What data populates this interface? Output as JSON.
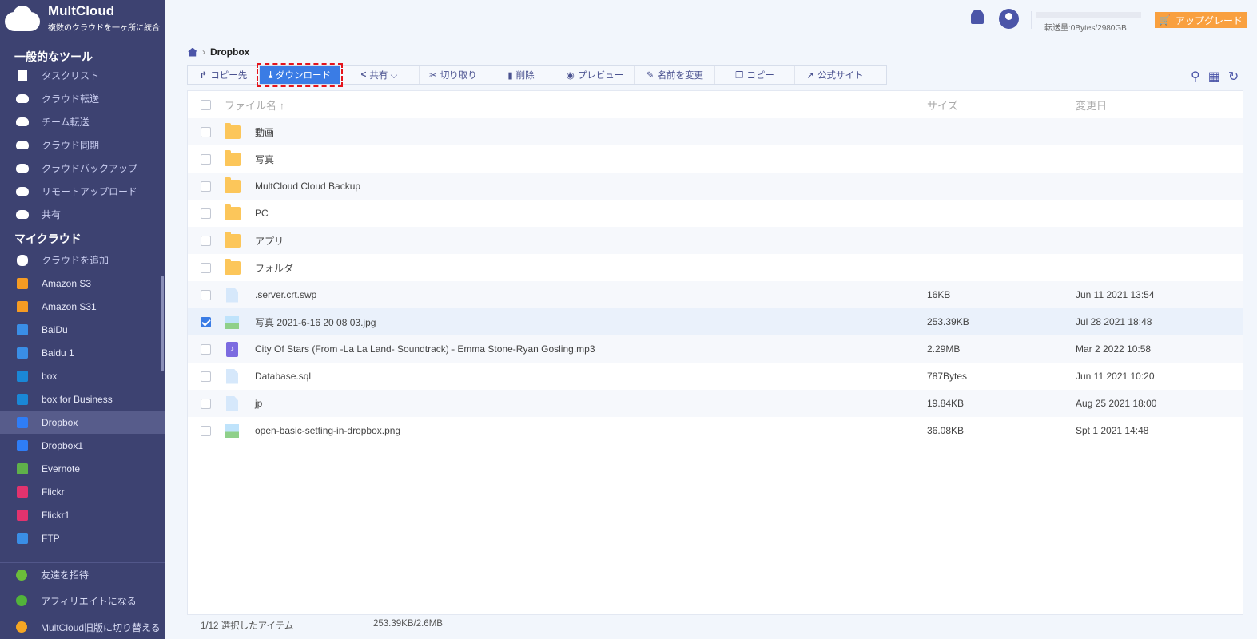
{
  "app": {
    "name": "MultCloud",
    "tagline": "複数のクラウドを一ヶ所に統合"
  },
  "sidebar": {
    "section_tools": "一般的なツール",
    "tools": [
      {
        "label": "タスクリスト",
        "icon": "clipboard-icon"
      },
      {
        "label": "クラウド転送",
        "icon": "cloud-transfer-icon"
      },
      {
        "label": "チーム転送",
        "icon": "team-transfer-icon"
      },
      {
        "label": "クラウド同期",
        "icon": "cloud-sync-icon"
      },
      {
        "label": "クラウドバックアップ",
        "icon": "cloud-backup-icon"
      },
      {
        "label": "リモートアップロード",
        "icon": "remote-upload-icon"
      },
      {
        "label": "共有",
        "icon": "share-icon"
      }
    ],
    "section_clouds": "マイクラウド",
    "clouds": [
      {
        "label": "クラウドを追加",
        "color": "#ffffff"
      },
      {
        "label": "Amazon S3",
        "color": "#f59b23"
      },
      {
        "label": "Amazon S31",
        "color": "#f59b23"
      },
      {
        "label": "BaiDu",
        "color": "#3a8ee6"
      },
      {
        "label": "Baidu 1",
        "color": "#3a8ee6"
      },
      {
        "label": "box",
        "color": "#1a87d6"
      },
      {
        "label": "box for Business",
        "color": "#1a87d6"
      },
      {
        "label": "Dropbox",
        "color": "#2f7df6"
      },
      {
        "label": "Dropbox1",
        "color": "#2f7df6"
      },
      {
        "label": "Evernote",
        "color": "#5fb14a"
      },
      {
        "label": "Flickr",
        "color": "#e2336e"
      },
      {
        "label": "Flickr1",
        "color": "#e2336e"
      },
      {
        "label": "FTP",
        "color": "#3a8ee6"
      }
    ],
    "bottom": [
      {
        "label": "友達を招待",
        "color": "#6bbd3a"
      },
      {
        "label": "アフィリエイトになる",
        "color": "#52b43a"
      },
      {
        "label": "MultCloud旧版に切り替える",
        "color": "#f5a623"
      }
    ]
  },
  "header": {
    "quota": "転送量:0Bytes/2980GB",
    "upgrade": "アップグレード"
  },
  "breadcrumb": {
    "current": "Dropbox"
  },
  "toolbar": [
    {
      "label": "コピー先",
      "glyph": "↱"
    },
    {
      "label": "ダウンロード",
      "glyph": "⤓"
    },
    {
      "label": "共有 ⌵",
      "glyph": "<"
    },
    {
      "label": "切り取り",
      "glyph": "✂"
    },
    {
      "label": "削除",
      "glyph": "▮"
    },
    {
      "label": "プレビュー",
      "glyph": "◉"
    },
    {
      "label": "名前を変更",
      "glyph": "✎"
    },
    {
      "label": "コピー",
      "glyph": "❐"
    },
    {
      "label": "公式サイト",
      "glyph": "➚"
    }
  ],
  "table": {
    "headers": {
      "name": "ファイル名 ↑",
      "size": "サイズ",
      "date": "変更日"
    },
    "rows": [
      {
        "name": "動画",
        "type": "folder",
        "size": "",
        "date": "",
        "checked": false
      },
      {
        "name": "写真",
        "type": "folder",
        "size": "",
        "date": "",
        "checked": false
      },
      {
        "name": "MultCloud Cloud Backup",
        "type": "folder",
        "size": "",
        "date": "",
        "checked": false
      },
      {
        "name": "PC",
        "type": "folder",
        "size": "",
        "date": "",
        "checked": false
      },
      {
        "name": "アプリ",
        "type": "folder",
        "size": "",
        "date": "",
        "checked": false
      },
      {
        "name": "フォルダ",
        "type": "folder",
        "size": "",
        "date": "",
        "checked": false
      },
      {
        "name": ".server.crt.swp",
        "type": "doc",
        "size": "16KB",
        "date": "Jun 11 2021 13:54",
        "checked": false
      },
      {
        "name": "写真 2021-6-16 20 08 03.jpg",
        "type": "img",
        "size": "253.39KB",
        "date": "Jul 28 2021 18:48",
        "checked": true
      },
      {
        "name": "City Of Stars (From -La La Land- Soundtrack) - Emma Stone-Ryan Gosling.mp3",
        "type": "music",
        "size": "2.29MB",
        "date": "Mar 2 2022 10:58",
        "checked": false
      },
      {
        "name": "Database.sql",
        "type": "doc",
        "size": "787Bytes",
        "date": "Jun 11 2021 10:20",
        "checked": false
      },
      {
        "name": "jp",
        "type": "doc",
        "size": "19.84KB",
        "date": "Aug 25 2021 18:00",
        "checked": false
      },
      {
        "name": "open-basic-setting-in-dropbox.png",
        "type": "img",
        "size": "36.08KB",
        "date": "Spt 1 2021 14:48",
        "checked": false
      }
    ]
  },
  "status": {
    "selected": "1/12 選択したアイテム",
    "size": "253.39KB/2.6MB"
  }
}
